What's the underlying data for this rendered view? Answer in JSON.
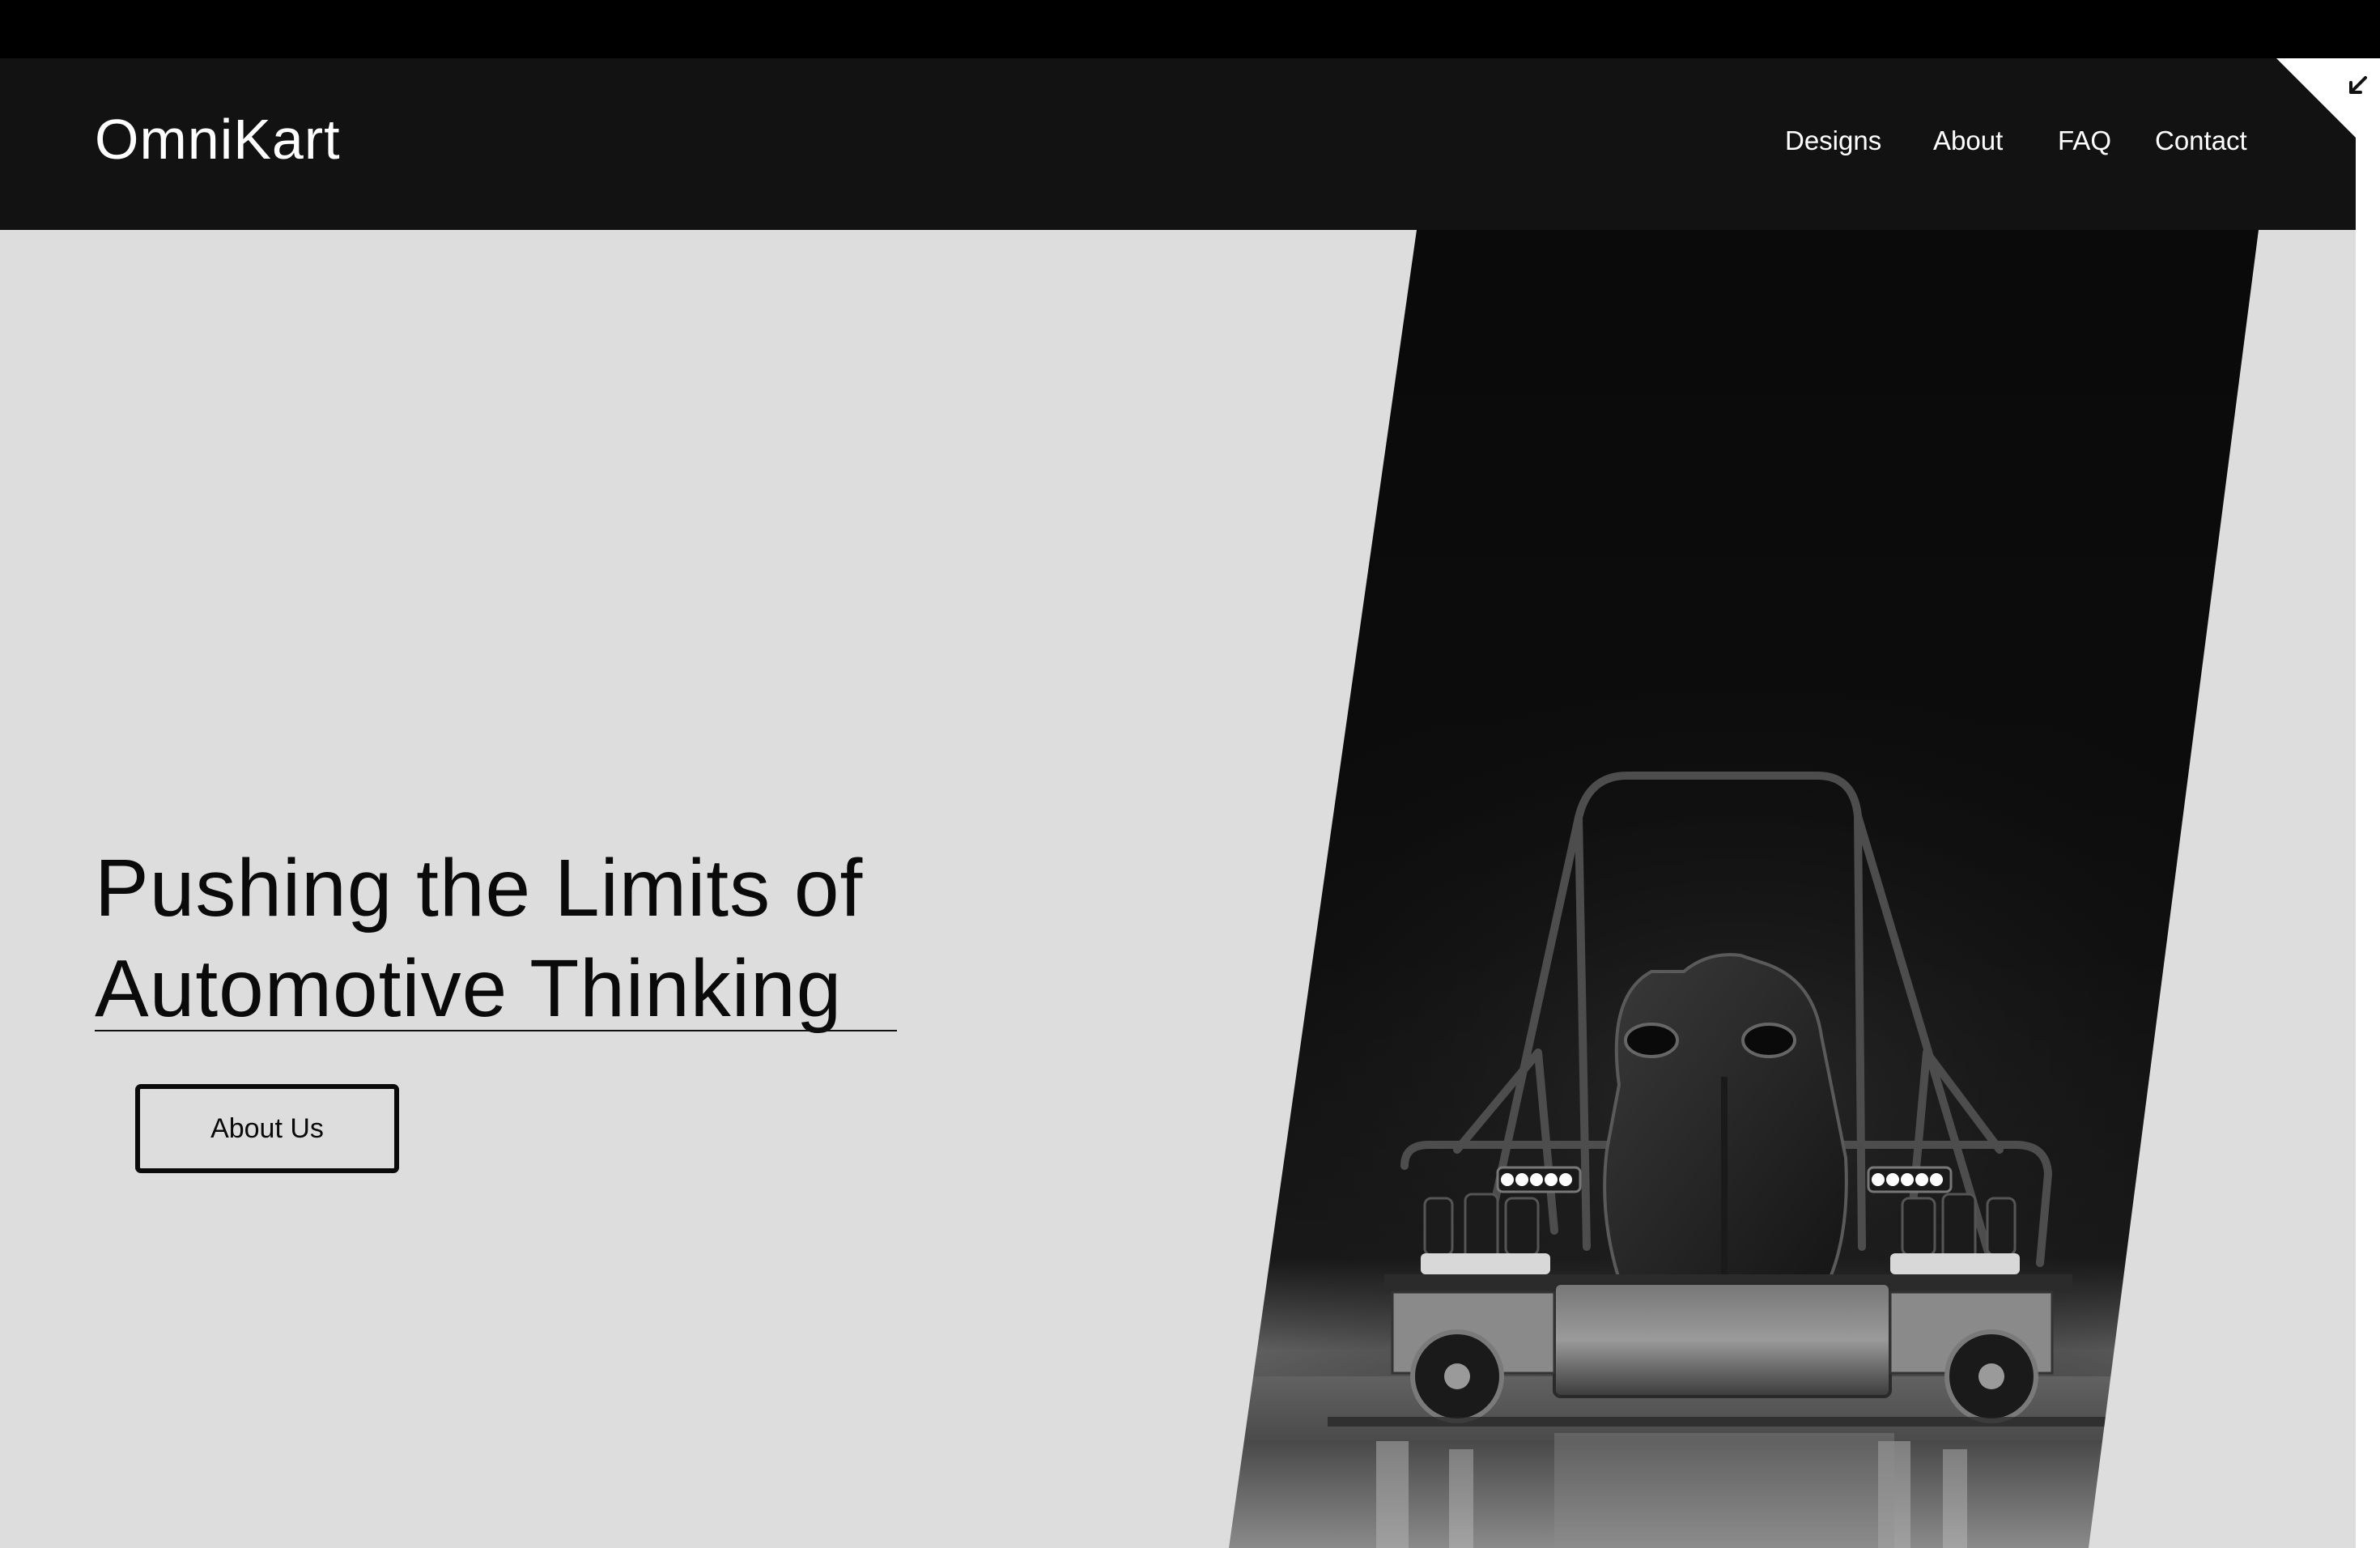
{
  "header": {
    "logo": "OmniKart",
    "nav": [
      {
        "label": "Designs"
      },
      {
        "label": "About"
      },
      {
        "label": "FAQ"
      },
      {
        "label": "Contact"
      }
    ]
  },
  "hero": {
    "title_line1": "Pushing the Limits of",
    "title_line2": "Automotive Thinking",
    "cta_label": "About Us",
    "image_subject": "go-kart-render"
  },
  "icons": {
    "corner": "arrow-down-left-icon"
  },
  "colors": {
    "page_background": "#dddddd",
    "header_background": "#121212",
    "top_strip": "#000000",
    "hero_panel": "#0c0c0c",
    "text_dark": "#0a0a0a",
    "text_light": "#ffffff"
  }
}
